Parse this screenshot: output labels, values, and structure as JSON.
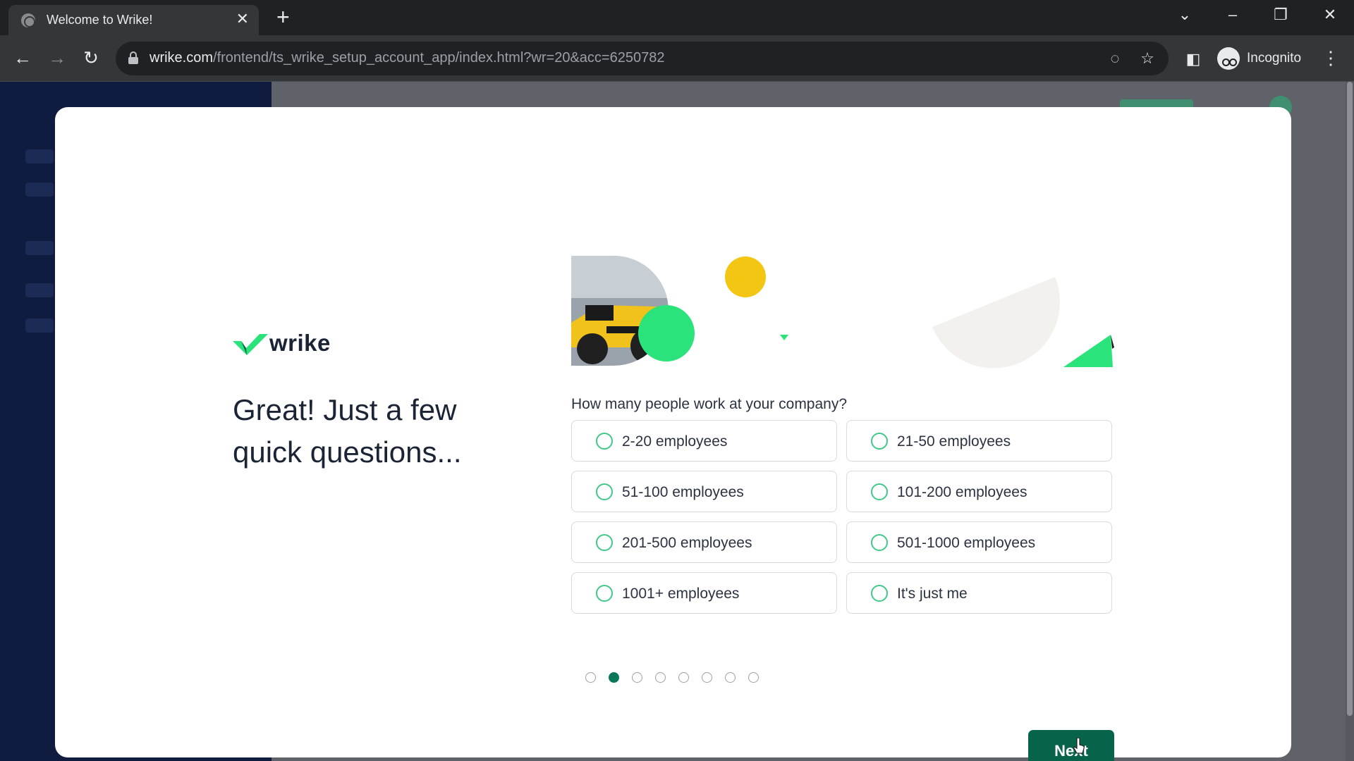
{
  "browser": {
    "tab_title": "Welcome to Wrike!",
    "url_host": "wrike.com",
    "url_path": "/frontend/ts_wrike_setup_account_app/index.html?wr=20&acc=6250782",
    "profile_label": "Incognito"
  },
  "logo": {
    "text": "wrike"
  },
  "headline": "Great! Just a few quick questions...",
  "question": "How many people work at your company?",
  "options": [
    "2-20 employees",
    "21-50 employees",
    "51-100 employees",
    "101-200 employees",
    "201-500 employees",
    "501-1000 employees",
    "1001+ employees",
    "It's just me"
  ],
  "progress": {
    "steps": 8,
    "current": 2
  },
  "next_button": "Next",
  "colors": {
    "brand_green": "#08634b",
    "accent_green": "#2ae37a",
    "radio_green": "#42c789",
    "yellow": "#f3c614",
    "text_dark": "#1b2435"
  }
}
